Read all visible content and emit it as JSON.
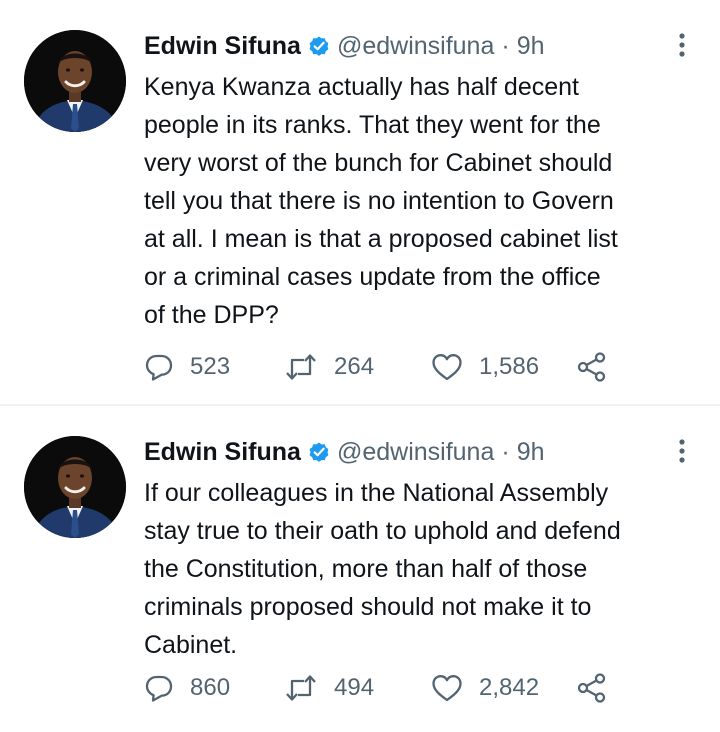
{
  "tweets": [
    {
      "author": {
        "name": "Edwin Sifuna",
        "handle": "@edwinsifuna",
        "verified": true
      },
      "separator": "·",
      "time": "9h",
      "text": "Kenya Kwanza actually has half decent\npeople in its ranks. That they went for the\nvery worst of the bunch for Cabinet should\ntell you that there is no intention to Govern\nat all. I mean is that a proposed cabinet list\nor a criminal cases update from the office\nof the DPP?",
      "replies": "523",
      "retweets": "264",
      "likes": "1,586"
    },
    {
      "author": {
        "name": "Edwin Sifuna",
        "handle": "@edwinsifuna",
        "verified": true
      },
      "separator": "·",
      "time": "9h",
      "text": "If our colleagues in the National Assembly\nstay true to their oath to uphold and defend\nthe Constitution, more than half of those\ncriminals proposed should not make it to\nCabinet.",
      "replies": "860",
      "retweets": "494",
      "likes": "2,842"
    }
  ],
  "icons": {
    "reply": "reply-icon",
    "retweet": "retweet-icon",
    "like": "like-icon",
    "share": "share-icon",
    "more": "more-icon",
    "verified": "verified-badge-icon"
  },
  "colors": {
    "text": "#0f1419",
    "secondary": "#536471",
    "verified": "#1d9bf0",
    "divider": "#eff3f4"
  }
}
